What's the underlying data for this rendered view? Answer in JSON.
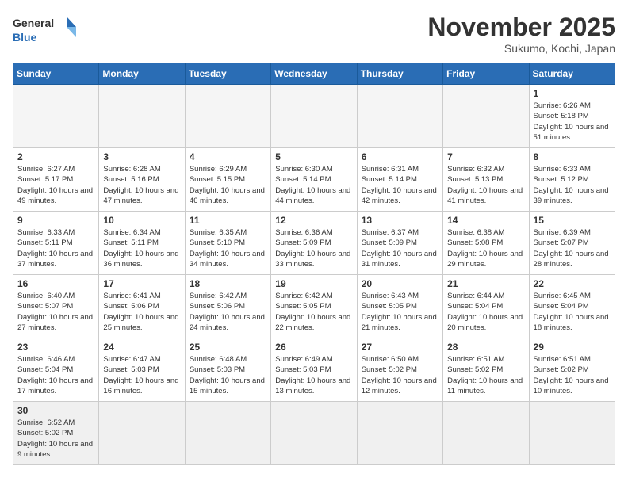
{
  "header": {
    "logo_general": "General",
    "logo_blue": "Blue",
    "month_title": "November 2025",
    "location": "Sukumo, Kochi, Japan"
  },
  "days_of_week": [
    "Sunday",
    "Monday",
    "Tuesday",
    "Wednesday",
    "Thursday",
    "Friday",
    "Saturday"
  ],
  "weeks": [
    [
      {
        "day": "",
        "info": ""
      },
      {
        "day": "",
        "info": ""
      },
      {
        "day": "",
        "info": ""
      },
      {
        "day": "",
        "info": ""
      },
      {
        "day": "",
        "info": ""
      },
      {
        "day": "",
        "info": ""
      },
      {
        "day": "1",
        "info": "Sunrise: 6:26 AM\nSunset: 5:18 PM\nDaylight: 10 hours and 51 minutes."
      }
    ],
    [
      {
        "day": "2",
        "info": "Sunrise: 6:27 AM\nSunset: 5:17 PM\nDaylight: 10 hours and 49 minutes."
      },
      {
        "day": "3",
        "info": "Sunrise: 6:28 AM\nSunset: 5:16 PM\nDaylight: 10 hours and 47 minutes."
      },
      {
        "day": "4",
        "info": "Sunrise: 6:29 AM\nSunset: 5:15 PM\nDaylight: 10 hours and 46 minutes."
      },
      {
        "day": "5",
        "info": "Sunrise: 6:30 AM\nSunset: 5:14 PM\nDaylight: 10 hours and 44 minutes."
      },
      {
        "day": "6",
        "info": "Sunrise: 6:31 AM\nSunset: 5:14 PM\nDaylight: 10 hours and 42 minutes."
      },
      {
        "day": "7",
        "info": "Sunrise: 6:32 AM\nSunset: 5:13 PM\nDaylight: 10 hours and 41 minutes."
      },
      {
        "day": "8",
        "info": "Sunrise: 6:33 AM\nSunset: 5:12 PM\nDaylight: 10 hours and 39 minutes."
      }
    ],
    [
      {
        "day": "9",
        "info": "Sunrise: 6:33 AM\nSunset: 5:11 PM\nDaylight: 10 hours and 37 minutes."
      },
      {
        "day": "10",
        "info": "Sunrise: 6:34 AM\nSunset: 5:11 PM\nDaylight: 10 hours and 36 minutes."
      },
      {
        "day": "11",
        "info": "Sunrise: 6:35 AM\nSunset: 5:10 PM\nDaylight: 10 hours and 34 minutes."
      },
      {
        "day": "12",
        "info": "Sunrise: 6:36 AM\nSunset: 5:09 PM\nDaylight: 10 hours and 33 minutes."
      },
      {
        "day": "13",
        "info": "Sunrise: 6:37 AM\nSunset: 5:09 PM\nDaylight: 10 hours and 31 minutes."
      },
      {
        "day": "14",
        "info": "Sunrise: 6:38 AM\nSunset: 5:08 PM\nDaylight: 10 hours and 29 minutes."
      },
      {
        "day": "15",
        "info": "Sunrise: 6:39 AM\nSunset: 5:07 PM\nDaylight: 10 hours and 28 minutes."
      }
    ],
    [
      {
        "day": "16",
        "info": "Sunrise: 6:40 AM\nSunset: 5:07 PM\nDaylight: 10 hours and 27 minutes."
      },
      {
        "day": "17",
        "info": "Sunrise: 6:41 AM\nSunset: 5:06 PM\nDaylight: 10 hours and 25 minutes."
      },
      {
        "day": "18",
        "info": "Sunrise: 6:42 AM\nSunset: 5:06 PM\nDaylight: 10 hours and 24 minutes."
      },
      {
        "day": "19",
        "info": "Sunrise: 6:42 AM\nSunset: 5:05 PM\nDaylight: 10 hours and 22 minutes."
      },
      {
        "day": "20",
        "info": "Sunrise: 6:43 AM\nSunset: 5:05 PM\nDaylight: 10 hours and 21 minutes."
      },
      {
        "day": "21",
        "info": "Sunrise: 6:44 AM\nSunset: 5:04 PM\nDaylight: 10 hours and 20 minutes."
      },
      {
        "day": "22",
        "info": "Sunrise: 6:45 AM\nSunset: 5:04 PM\nDaylight: 10 hours and 18 minutes."
      }
    ],
    [
      {
        "day": "23",
        "info": "Sunrise: 6:46 AM\nSunset: 5:04 PM\nDaylight: 10 hours and 17 minutes."
      },
      {
        "day": "24",
        "info": "Sunrise: 6:47 AM\nSunset: 5:03 PM\nDaylight: 10 hours and 16 minutes."
      },
      {
        "day": "25",
        "info": "Sunrise: 6:48 AM\nSunset: 5:03 PM\nDaylight: 10 hours and 15 minutes."
      },
      {
        "day": "26",
        "info": "Sunrise: 6:49 AM\nSunset: 5:03 PM\nDaylight: 10 hours and 13 minutes."
      },
      {
        "day": "27",
        "info": "Sunrise: 6:50 AM\nSunset: 5:02 PM\nDaylight: 10 hours and 12 minutes."
      },
      {
        "day": "28",
        "info": "Sunrise: 6:51 AM\nSunset: 5:02 PM\nDaylight: 10 hours and 11 minutes."
      },
      {
        "day": "29",
        "info": "Sunrise: 6:51 AM\nSunset: 5:02 PM\nDaylight: 10 hours and 10 minutes."
      }
    ],
    [
      {
        "day": "30",
        "info": "Sunrise: 6:52 AM\nSunset: 5:02 PM\nDaylight: 10 hours and 9 minutes."
      },
      {
        "day": "",
        "info": ""
      },
      {
        "day": "",
        "info": ""
      },
      {
        "day": "",
        "info": ""
      },
      {
        "day": "",
        "info": ""
      },
      {
        "day": "",
        "info": ""
      },
      {
        "day": "",
        "info": ""
      }
    ]
  ]
}
